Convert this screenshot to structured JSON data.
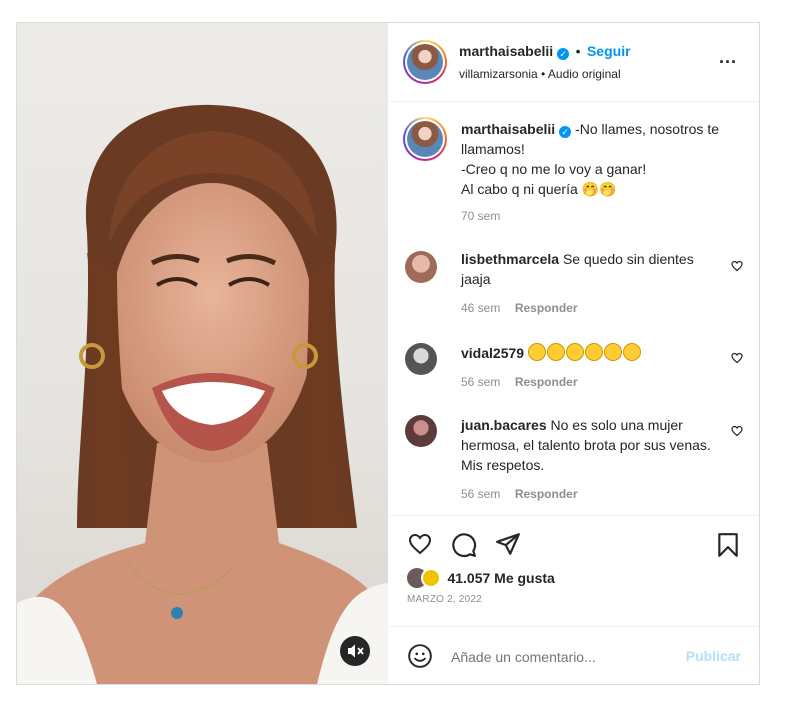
{
  "header": {
    "username": "marthaisabelii",
    "separator": "•",
    "follow_label": "Seguir",
    "audio_line": "villamizarsonia • Audio original",
    "more_label": "..."
  },
  "caption": {
    "username": "marthaisabelii",
    "line1": "-No llames, nosotros te llamamos!",
    "line2": "-Creo q no me lo voy a ganar!",
    "line3": "Al cabo q ni quería 🤭🤭",
    "time": "70 sem"
  },
  "comments": [
    {
      "username": "lisbethmarcela",
      "text": "Se quedo sin dientes jaaja",
      "time": "46 sem",
      "reply": "Responder"
    },
    {
      "username": "vidal2579",
      "text": "😂😂😂😂😂😂",
      "time": "56 sem",
      "reply": "Responder"
    },
    {
      "username": "juan.bacares",
      "text": "No es solo una mujer hermosa, el talento brota por sus venas. Mis respetos.",
      "time": "56 sem",
      "reply": "Responder"
    }
  ],
  "likes": {
    "count_text": "41.057 Me gusta",
    "date": "MARZO 2, 2022"
  },
  "add_comment": {
    "placeholder": "Añade un comentario...",
    "publish_label": "Publicar"
  },
  "colors": {
    "accent": "#0095f6",
    "text": "#262626",
    "muted": "#8e8e8e",
    "border": "#dbdbdb",
    "publish_disabled": "#b2dffc"
  },
  "icons": [
    "verified-badge-icon",
    "more-options-icon",
    "heart-icon",
    "comment-icon",
    "share-icon",
    "bookmark-icon",
    "emoji-icon",
    "mute-icon"
  ]
}
